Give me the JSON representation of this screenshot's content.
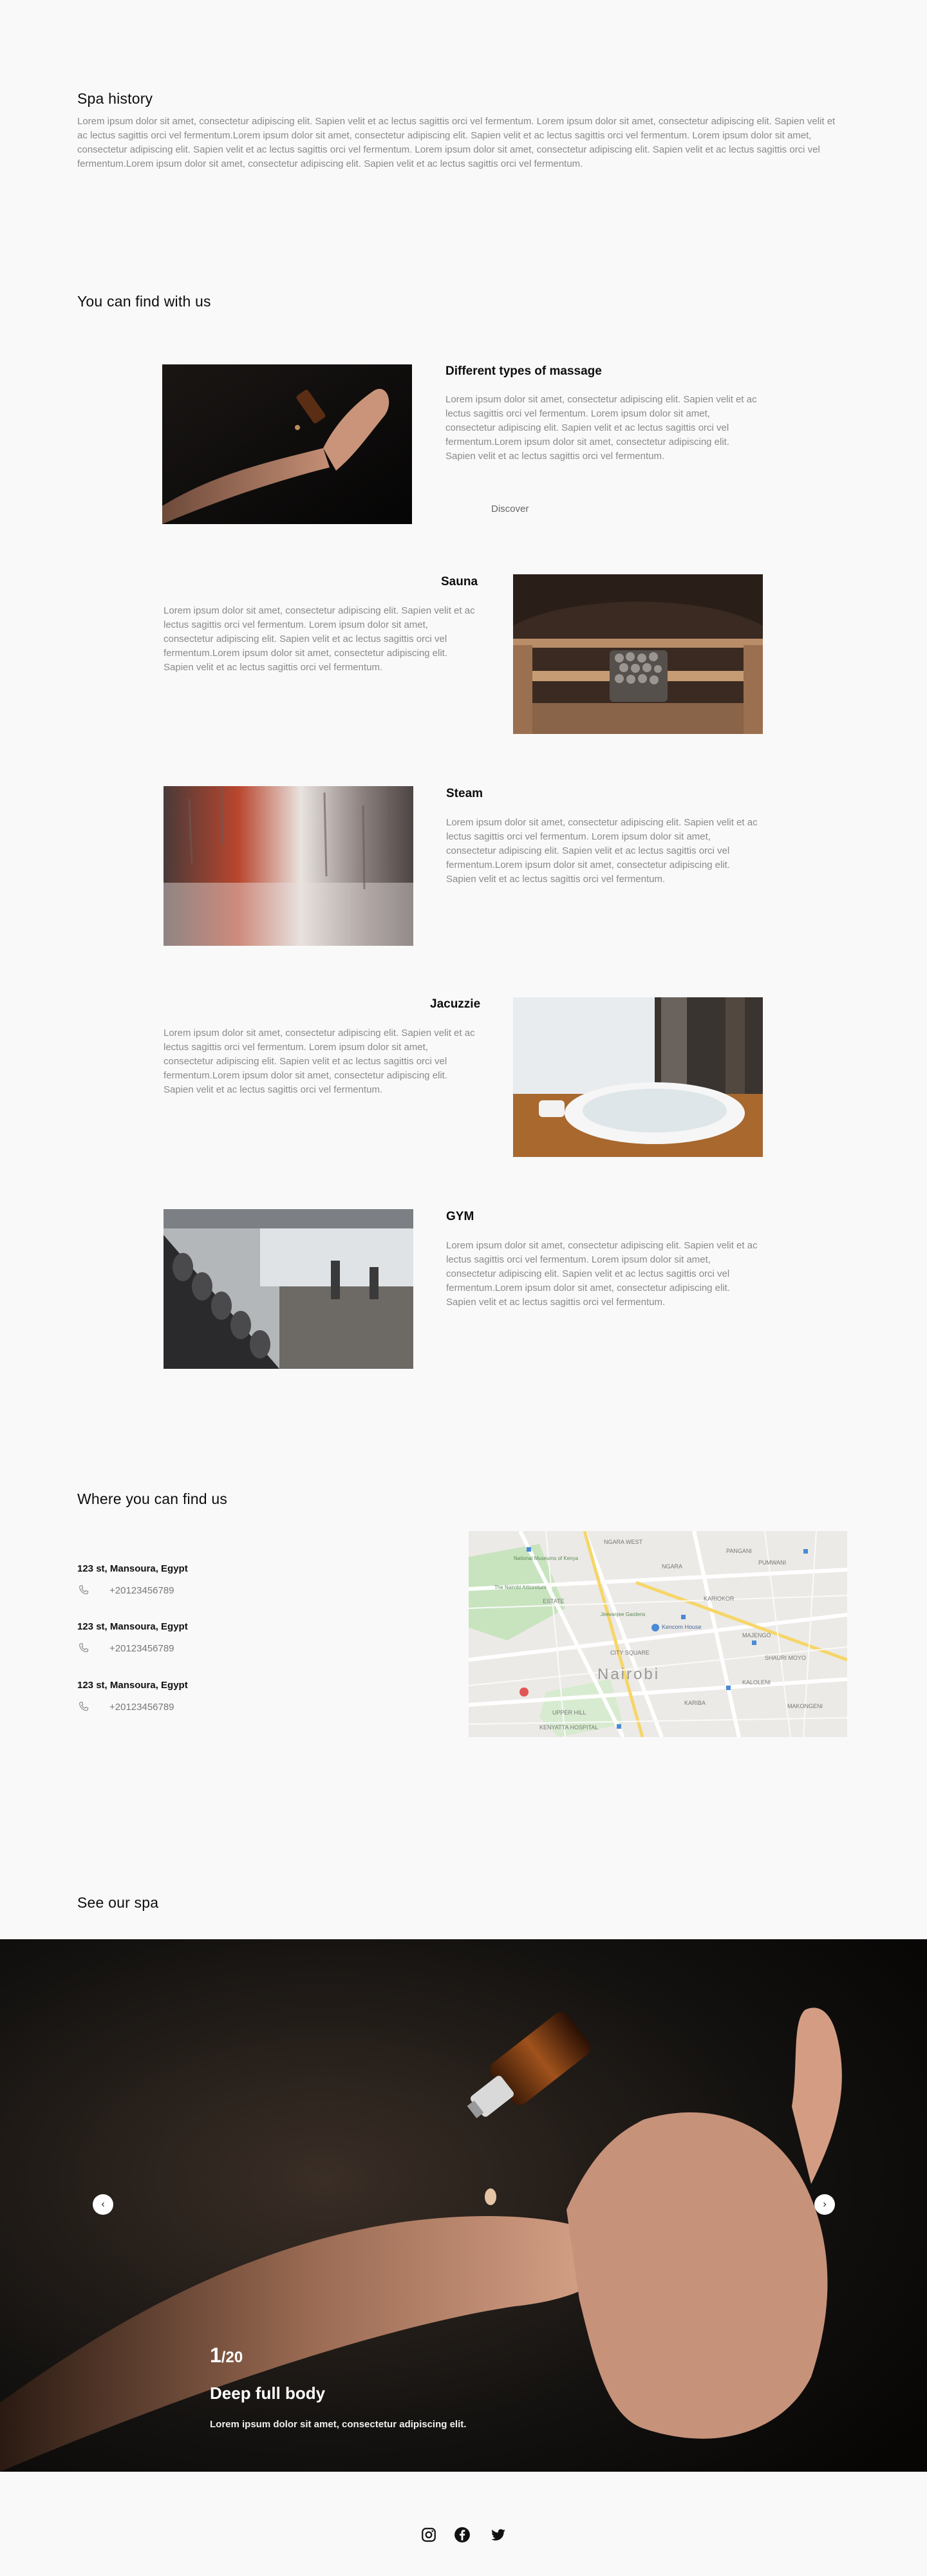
{
  "history": {
    "title": "Spa history",
    "text": "Lorem ipsum dolor sit amet, consectetur adipiscing elit. Sapien velit et ac lectus sagittis orci vel fermentum. Lorem ipsum dolor sit amet, consectetur adipiscing elit. Sapien velit et ac lectus sagittis orci vel fermentum.Lorem ipsum dolor sit amet, consectetur adipiscing elit. Sapien velit et ac lectus sagittis orci vel fermentum. Lorem ipsum dolor sit amet, consectetur adipiscing elit. Sapien velit et ac lectus sagittis orci vel fermentum. Lorem ipsum dolor sit amet, consectetur adipiscing elit. Sapien velit et ac lectus sagittis orci vel fermentum.Lorem ipsum dolor sit amet, consectetur adipiscing elit. Sapien velit et ac lectus sagittis orci vel fermentum."
  },
  "services": {
    "title": "You can find with us",
    "items": [
      {
        "title": "Different types of massage",
        "text": "Lorem ipsum dolor sit amet, consectetur adipiscing elit. Sapien velit et ac lectus sagittis orci vel fermentum. Lorem ipsum dolor sit amet, consectetur adipiscing elit. Sapien velit et ac lectus sagittis orci vel fermentum.Lorem ipsum dolor sit amet, consectetur adipiscing elit. Sapien velit et ac lectus sagittis orci vel fermentum.",
        "action": "Discover"
      },
      {
        "title": "Sauna",
        "text": "Lorem ipsum dolor sit amet, consectetur adipiscing elit. Sapien velit et ac lectus sagittis orci vel fermentum. Lorem ipsum dolor sit amet, consectetur adipiscing elit. Sapien velit et ac lectus sagittis orci vel fermentum.Lorem ipsum dolor sit amet, consectetur adipiscing elit. Sapien velit et ac lectus sagittis orci vel fermentum."
      },
      {
        "title": "Steam",
        "text": "Lorem ipsum dolor sit amet, consectetur adipiscing elit. Sapien velit et ac lectus sagittis orci vel fermentum. Lorem ipsum dolor sit amet, consectetur adipiscing elit. Sapien velit et ac lectus sagittis orci vel fermentum.Lorem ipsum dolor sit amet, consectetur adipiscing elit. Sapien velit et ac lectus sagittis orci vel fermentum."
      },
      {
        "title": "Jacuzzie",
        "text": "Lorem ipsum dolor sit amet, consectetur adipiscing elit. Sapien velit et ac lectus sagittis orci vel fermentum. Lorem ipsum dolor sit amet, consectetur adipiscing elit. Sapien velit et ac lectus sagittis orci vel fermentum.Lorem ipsum dolor sit amet, consectetur adipiscing elit. Sapien velit et ac lectus sagittis orci vel fermentum."
      },
      {
        "title": "GYM",
        "text": "Lorem ipsum dolor sit amet, consectetur adipiscing elit. Sapien velit et ac lectus sagittis orci vel fermentum. Lorem ipsum dolor sit amet, consectetur adipiscing elit. Sapien velit et ac lectus sagittis orci vel fermentum.Lorem ipsum dolor sit amet, consectetur adipiscing elit. Sapien velit et ac lectus sagittis orci vel fermentum."
      }
    ]
  },
  "location": {
    "title": "Where you can find us",
    "branches": [
      {
        "address": "123 st, Mansoura, Egypt",
        "phone": "+20123456789"
      },
      {
        "address": "123 st, Mansoura, Egypt",
        "phone": "+20123456789"
      },
      {
        "address": "123 st, Mansoura, Egypt",
        "phone": "+20123456789"
      }
    ],
    "map_labels": {
      "city": "Nairobi",
      "ngara": "NGARA",
      "ngara_west": "NGARA WEST",
      "pangani": "PANGANI",
      "pumwani": "PUMWANI",
      "kariokor": "KARIOKOR",
      "majengo": "MAJENGO",
      "shauri_moyo": "SHAURI MOYO",
      "kaloleni": "KALOLENI",
      "makongeni": "MAKONGENI",
      "kariba": "KARIBA",
      "upper_hill": "UPPER HILL",
      "city_square": "CITY SQUARE",
      "estate": "ESTATE",
      "museum": "National Museums of Kenya",
      "arboretum": "The Nairobi Arboretum",
      "jeevanjee": "Jeevanjee Gardens",
      "kenyatta": "KENYATTA HOSPITAL",
      "kencom": "Kencom House"
    }
  },
  "gallery": {
    "title": "See our spa",
    "current": "1",
    "total": "/20",
    "slide_title": "Deep full body",
    "slide_desc": "Lorem ipsum dolor sit amet, consectetur adipiscing elit.",
    "prev_icon": "‹",
    "next_icon": "›"
  },
  "footer": {
    "social": [
      "instagram-icon",
      "facebook-icon",
      "twitter-icon"
    ]
  }
}
